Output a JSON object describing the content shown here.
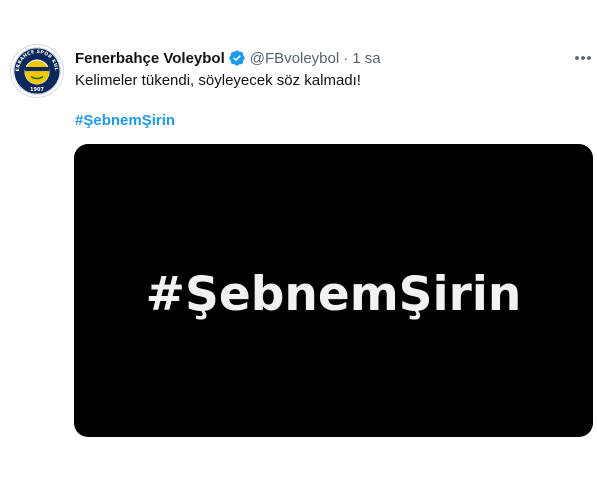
{
  "tweet": {
    "author": {
      "display_name": "Fenerbahçe Voleybol",
      "handle": "@FBvoleybol",
      "verified": true,
      "avatar": "fenerbahce-crest-icon",
      "avatar_text": "FENERBAHÇE SPOR KULÜBÜ",
      "avatar_year": "1907"
    },
    "separator": "·",
    "time": "1 sa",
    "text": "Kelimeler tükendi, söyleyecek söz kalmadı!",
    "hashtag": "#ŞebnemŞirin",
    "media": {
      "text": "#ŞebnemŞirin",
      "background": "#000000"
    }
  },
  "colors": {
    "link": "#1d9bf0",
    "secondary_text": "#536471",
    "primary_text": "#0f1419",
    "verified": "#1d9bf0",
    "crest_navy": "#0b2a5b",
    "crest_yellow": "#f3c600"
  },
  "icons": {
    "verified": "verified-badge-icon",
    "more": "more-horizontal-icon"
  }
}
